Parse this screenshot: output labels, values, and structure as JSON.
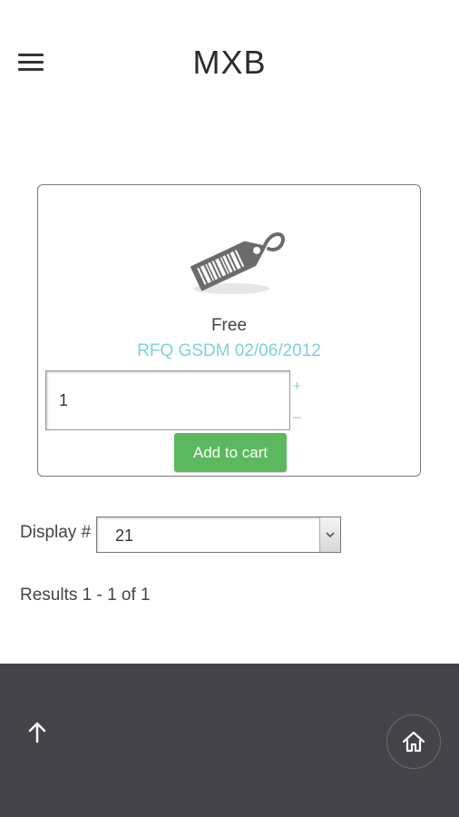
{
  "header": {
    "title": "MXB",
    "menu_icon": "hamburger-menu-icon"
  },
  "product": {
    "image_icon": "price-tag-barcode-icon",
    "price": "Free",
    "name": "RFQ GSDM 02/06/2012",
    "quantity": "1",
    "plus": "+",
    "minus": "–",
    "add_to_cart_label": "Add to cart"
  },
  "listing": {
    "display_label": "Display #",
    "display_value": "21",
    "results_text": "Results 1 - 1 of 1"
  },
  "footer": {
    "back_to_top_icon": "arrow-up-icon",
    "home_icon": "home-icon"
  },
  "colors": {
    "accent_link": "#7dd1d8",
    "button_green": "#5cb85c",
    "footer_bg": "#434349"
  }
}
